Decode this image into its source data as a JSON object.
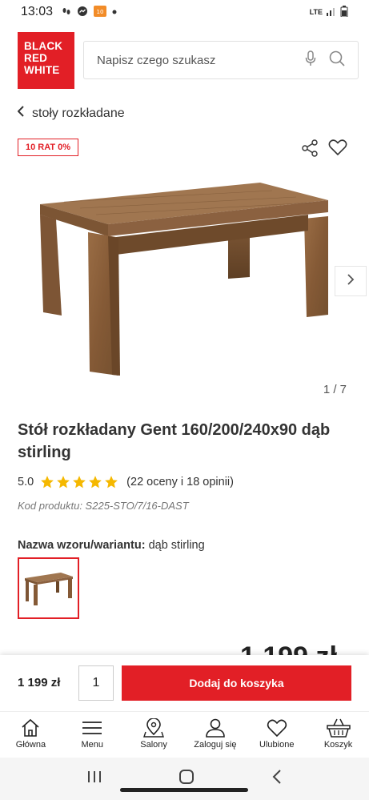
{
  "status": {
    "time": "13:03",
    "network": "LTE"
  },
  "brand": {
    "line1": "BLACK",
    "line2": "RED",
    "line3": "WHITE",
    "color": "#e21f26"
  },
  "search": {
    "placeholder": "Napisz czego szukasz"
  },
  "breadcrumb": {
    "label": "stoły rozkładane"
  },
  "badge": "10 RAT 0%",
  "gallery": {
    "pager": "1 / 7"
  },
  "product": {
    "title": "Stół rozkładany Gent 160/200/240x90 dąb stirling",
    "rating_value": "5.0",
    "stars": 5,
    "rating_text": "(22 oceny i 18 opinii)",
    "code": "Kod produktu: S225-STO/7/16-DAST",
    "variant_label": "Nazwa wzoru/wariantu:",
    "variant_value": "dąb stirling",
    "price_partial": "1 199 zł"
  },
  "buy_bar": {
    "price": "1 199 zł",
    "quantity": "1",
    "add_label": "Dodaj do koszyka"
  },
  "nav": [
    {
      "label": "Główna",
      "icon": "home-icon"
    },
    {
      "label": "Menu",
      "icon": "menu-icon"
    },
    {
      "label": "Salony",
      "icon": "map-pin-icon"
    },
    {
      "label": "Zaloguj się",
      "icon": "user-icon"
    },
    {
      "label": "Ulubione",
      "icon": "heart-icon"
    },
    {
      "label": "Koszyk",
      "icon": "basket-icon"
    }
  ]
}
